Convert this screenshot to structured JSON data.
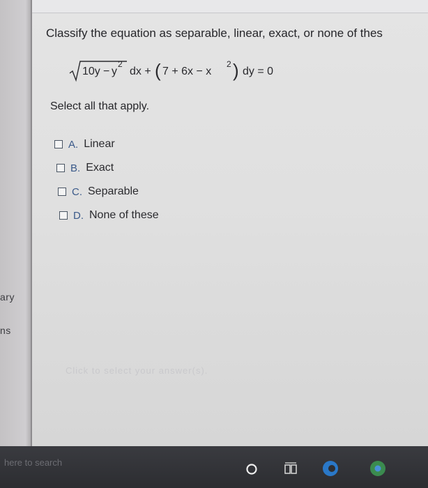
{
  "question": "Classify the equation as separable, linear, exact, or none of thes",
  "equation": {
    "sqrt_radicand_a": "10y",
    "sqrt_minus": "−",
    "sqrt_radicand_b": "y",
    "exp_2a": "2",
    "dx_part": "dx +",
    "paren_open": "(",
    "inner_a": "7 + 6x − x",
    "exp_2b": "2",
    "paren_close": ")",
    "dy_part": "dy = 0"
  },
  "instruction": "Select all that apply.",
  "options": [
    {
      "letter": "A.",
      "text": "Linear"
    },
    {
      "letter": "B.",
      "text": "Exact"
    },
    {
      "letter": "C.",
      "text": "Separable"
    },
    {
      "letter": "D.",
      "text": "None of these"
    }
  ],
  "sidebar": {
    "label1": "ary",
    "label2": "ns"
  },
  "hint": "Click to select your answer(s).",
  "taskbar": {
    "search_text": "here to search"
  },
  "colors": {
    "accent": "#3b5a8a",
    "taskbar": "#2e2f33"
  }
}
